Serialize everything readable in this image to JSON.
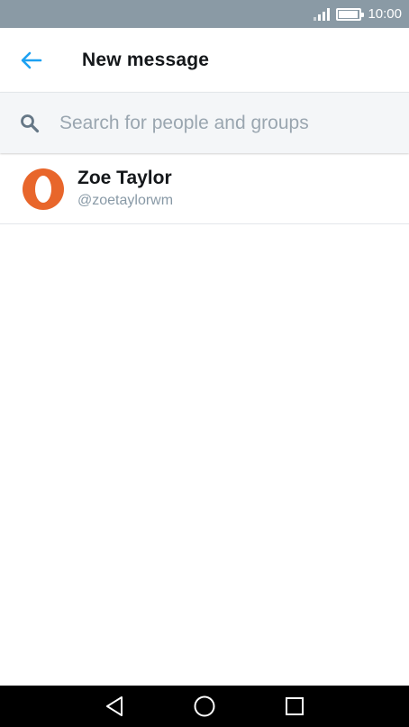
{
  "status_bar": {
    "time": "10:00",
    "battery_level": 0.95,
    "signal_bars": 4
  },
  "header": {
    "back_icon": "arrow-left-icon",
    "title": "New message",
    "accent_color": "#1da1f2"
  },
  "search": {
    "icon": "search-icon",
    "placeholder": "Search for people and groups",
    "value": ""
  },
  "results": [
    {
      "name": "Zoe Taylor",
      "handle": "@zoetaylorwm",
      "avatar_color": "#e8662b"
    }
  ],
  "nav_bar": {
    "icons": [
      "back-triangle-icon",
      "home-circle-icon",
      "recents-square-icon"
    ]
  }
}
